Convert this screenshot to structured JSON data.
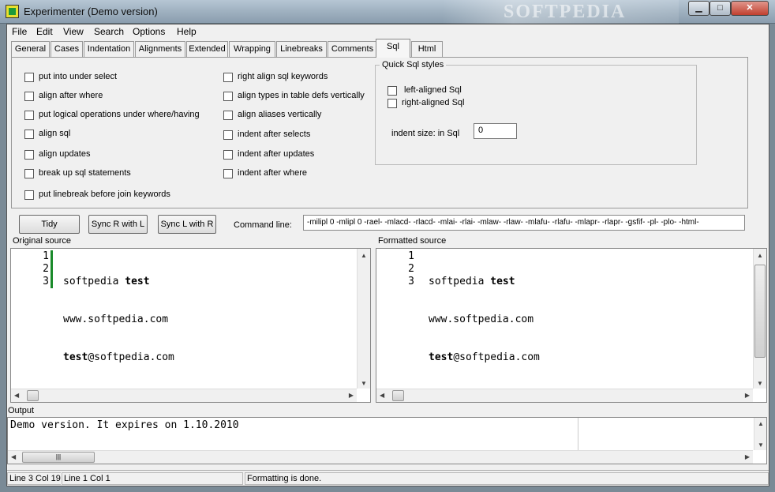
{
  "window": {
    "title": "Experimenter (Demo version)",
    "watermark": "SOFTPEDIA",
    "min_glyph": "▁",
    "max_glyph": "□",
    "close_glyph": "✕"
  },
  "menu": [
    "File",
    "Edit",
    "View",
    "Search",
    "Options",
    "Help"
  ],
  "tabs": [
    "General",
    "Cases",
    "Indentation",
    "Alignments",
    "Extended",
    "Wrapping",
    "Linebreaks",
    "Comments",
    "Sql",
    "Html"
  ],
  "active_tab": "Sql",
  "options_col1": [
    "put into under select",
    "align after where",
    "put logical operations under where/having",
    "align sql",
    "align updates",
    "break up sql statements",
    "put linebreak before join keywords"
  ],
  "options_col2": [
    "right align sql keywords",
    "align types in table defs vertically",
    "align aliases vertically",
    "indent after selects",
    "indent after updates",
    "indent after where"
  ],
  "quick": {
    "title": "Quick Sql styles",
    "left": "left-aligned Sql",
    "right": "right-aligned Sql",
    "indent_label": "indent size: in Sql",
    "indent_value": "0"
  },
  "buttons": {
    "tidy": "Tidy",
    "sync_r": "Sync R with L",
    "sync_l": "Sync L with R"
  },
  "command": {
    "label": "Command line:",
    "value": "-milipl 0 -mlipl 0 -rael- -mlacd- -rlacd- -mlai- -rlai- -mlaw- -rlaw- -mlafu- -rlafu- -mlapr- -rlapr- -gsfif- -pl- -plo- -html-"
  },
  "left_pane": {
    "label": "Original source",
    "line_numbers": [
      "1",
      "2",
      "3"
    ],
    "lines": [
      "softpedia test",
      "www.softpedia.com",
      "test@softpedia.com"
    ]
  },
  "right_pane": {
    "label": "Formatted source",
    "line_numbers": [
      "1",
      "2",
      "3"
    ],
    "lines": [
      "softpedia test",
      "www.softpedia.com",
      "test@softpedia.com"
    ]
  },
  "output": {
    "label": "Output",
    "text": "Demo version. It expires on 1.10.2010"
  },
  "status": {
    "position": "Line 3 Col 19",
    "position2": "Line 1 Col 1",
    "message": "Formatting is done."
  },
  "scroll_glyphs": {
    "up": "▲",
    "down": "▼",
    "left": "◀",
    "right": "▶",
    "grip": "|||"
  }
}
